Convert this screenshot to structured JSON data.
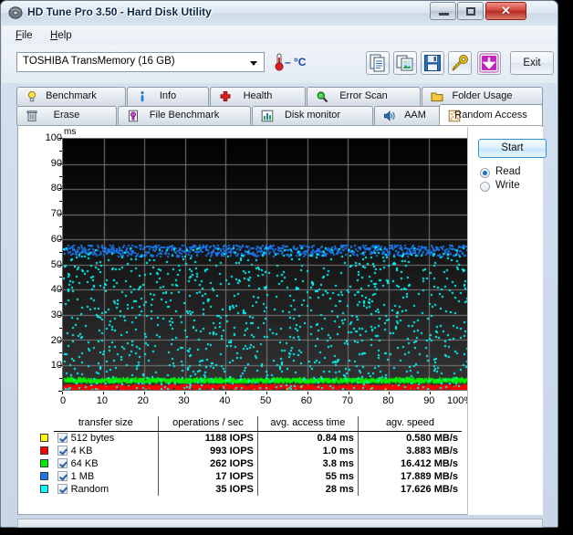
{
  "window": {
    "title": "HD Tune Pro 3.50 - Hard Disk Utility",
    "icon": "disk-icon",
    "buttons": {
      "minimize": "minimize-icon",
      "maximize": "maximize-icon",
      "close": "✕"
    }
  },
  "menu": {
    "file": "File",
    "file_accel": "F",
    "help": "Help",
    "help_accel": "H"
  },
  "toolbar": {
    "drive": "TOSHIBA TransMemory (16 GB)",
    "temperature": "– °C",
    "buttons": [
      {
        "name": "copy-text-icon",
        "title": "Copy to clipboard (text)"
      },
      {
        "name": "copy-image-icon",
        "title": "Copy to clipboard (image)"
      },
      {
        "name": "save-icon",
        "title": "Save"
      },
      {
        "name": "tools-icon",
        "title": "Options"
      },
      {
        "name": "download-icon",
        "title": "Check for updates"
      }
    ],
    "exit_label": "Exit"
  },
  "tabs": {
    "row1": [
      {
        "label": "Benchmark",
        "icon": "lightbulb-icon",
        "active": false
      },
      {
        "label": "Info",
        "icon": "info-icon",
        "active": false
      },
      {
        "label": "Health",
        "icon": "health-cross-icon",
        "active": false
      },
      {
        "label": "Error Scan",
        "icon": "magnifier-icon",
        "active": false
      },
      {
        "label": "Folder Usage",
        "icon": "folder-icon",
        "active": false
      }
    ],
    "row2": [
      {
        "label": "Erase",
        "icon": "trash-icon",
        "active": false
      },
      {
        "label": "File Benchmark",
        "icon": "file-benchmark-icon",
        "active": false
      },
      {
        "label": "Disk monitor",
        "icon": "bar-chart-icon",
        "active": false
      },
      {
        "label": "AAM",
        "icon": "speaker-icon",
        "active": false
      },
      {
        "label": "Random Access",
        "icon": "scatter-icon",
        "active": true
      }
    ]
  },
  "controls": {
    "start_label": "Start",
    "mode_read": "Read",
    "mode_write": "Write",
    "mode_selected": "Read"
  },
  "table": {
    "headers": [
      "transfer size",
      "operations / sec",
      "avg. access time",
      "agv. speed"
    ],
    "rows": [
      {
        "color": "#FFFF00",
        "checked": true,
        "size": "512 bytes",
        "iops": "1188 IOPS",
        "access": "0.84 ms",
        "speed": "0.580 MB/s"
      },
      {
        "color": "#FF0000",
        "checked": true,
        "size": "4 KB",
        "iops": "993 IOPS",
        "access": "1.0 ms",
        "speed": "3.883 MB/s"
      },
      {
        "color": "#00EE00",
        "checked": true,
        "size": "64 KB",
        "iops": "262 IOPS",
        "access": "3.8 ms",
        "speed": "16.412 MB/s"
      },
      {
        "color": "#1878F0",
        "checked": true,
        "size": "1 MB",
        "iops": "17 IOPS",
        "access": "55 ms",
        "speed": "17.889 MB/s"
      },
      {
        "color": "#00FFFF",
        "checked": true,
        "size": "Random",
        "iops": "35 IOPS",
        "access": "28 ms",
        "speed": "17.626 MB/s"
      }
    ]
  },
  "chart_data": {
    "type": "scatter",
    "title": "",
    "xlabel": "",
    "ylabel": "ms",
    "unit_label": "ms",
    "xlim": [
      0,
      100
    ],
    "ylim": [
      0,
      100
    ],
    "xticks": [
      0,
      10,
      20,
      30,
      40,
      50,
      60,
      70,
      80,
      90,
      100
    ],
    "xticklabels": [
      "0",
      "10",
      "20",
      "30",
      "40",
      "50",
      "60",
      "70",
      "80",
      "90",
      "100%"
    ],
    "yticks": [
      0,
      10,
      20,
      30,
      40,
      50,
      60,
      70,
      80,
      90,
      100
    ],
    "yticklabels": [
      "0",
      "10",
      "20",
      "30",
      "40",
      "50",
      "60",
      "70",
      "80",
      "90",
      "100"
    ],
    "grid": true,
    "background": "#151515",
    "series": [
      {
        "name": "512 bytes",
        "color": "#FFFF00",
        "mean_ms": 0.84,
        "band": [
          0.3,
          1.6
        ],
        "density": 0.25,
        "count": 420
      },
      {
        "name": "4 KB",
        "color": "#FF0000",
        "mean_ms": 1.0,
        "band": [
          0.6,
          1.9
        ],
        "density": 1.0,
        "count": 900
      },
      {
        "name": "64 KB",
        "color": "#00EE00",
        "mean_ms": 3.8,
        "band": [
          3.2,
          4.6
        ],
        "density": 1.0,
        "count": 900
      },
      {
        "name": "1 MB",
        "color": "#1878F0",
        "mean_ms": 55,
        "band": [
          53.5,
          58.0
        ],
        "density": 1.0,
        "count": 760
      },
      {
        "name": "Random",
        "color": "#00FFFF",
        "mean_ms": 28,
        "band": [
          0.5,
          57.0
        ],
        "density": 0.5,
        "count": 1150
      }
    ]
  },
  "statusbar": {
    "text": ""
  }
}
